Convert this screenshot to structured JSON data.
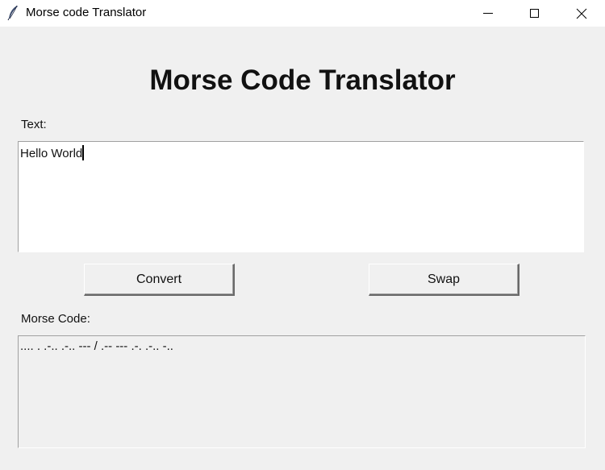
{
  "window": {
    "title": "Morse code Translator",
    "icon": "feather-icon",
    "controls": [
      "minimize-icon",
      "maximize-icon",
      "close-icon"
    ]
  },
  "main": {
    "heading": "Morse Code Translator",
    "text_label": "Text:",
    "text_value": "Hello World",
    "convert_label": "Convert",
    "swap_label": "Swap",
    "morse_label": "Morse Code:",
    "morse_value": ".... . .-.. .-.. --- / .-- --- .-. .-.. -.."
  }
}
